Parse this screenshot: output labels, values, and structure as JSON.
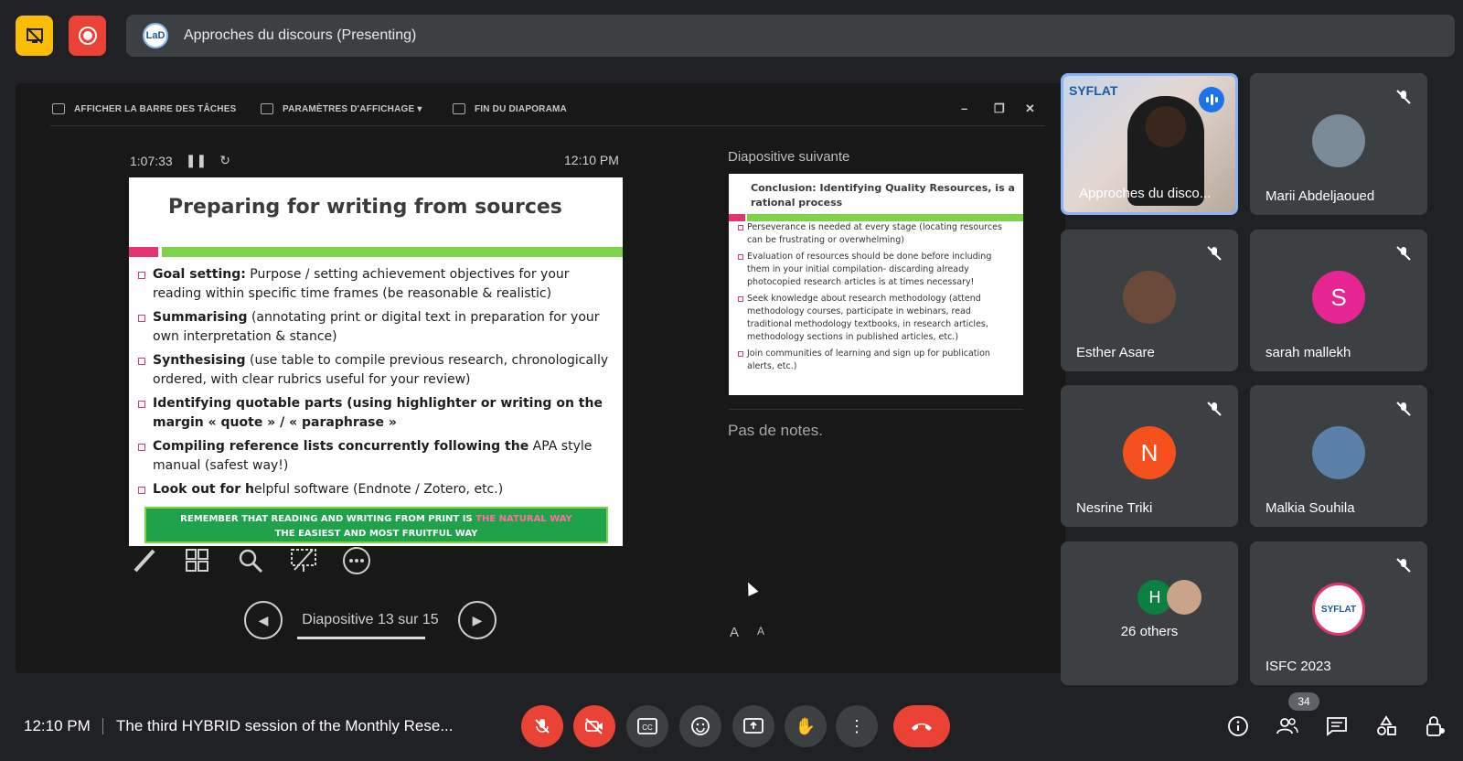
{
  "topbar": {
    "presentation_title": "Approches du discours (Presenting)",
    "logo_text": "LaD",
    "colors": {
      "stop_presenting_bg": "#fbbc04",
      "record_bg": "#ea4335"
    }
  },
  "powerpoint": {
    "toolbar": {
      "taskbar": "AFFICHER LA BARRE DES TÂCHES",
      "display_settings": "PARAMÈTRES D'AFFICHAGE ▾",
      "end_slideshow": "FIN DU DIAPORAMA"
    },
    "timer": "1:07:33",
    "clock": "12:10 PM",
    "current_slide": {
      "title": "Preparing for writing from sources",
      "bullets": [
        {
          "bold": "Goal setting:",
          "text": " Purpose / setting achievement objectives for your reading within specific time frames (be reasonable & realistic)"
        },
        {
          "bold": "Summarising",
          "text": " (annotating print or digital text in preparation for your own interpretation & stance)"
        },
        {
          "bold": "Synthesising",
          "text": " (use table to compile previous research, chronologically ordered, with clear rubrics useful for your review)"
        },
        {
          "bold": "Identifying quotable parts (using highlighter or writing on the margin « quote » / « paraphrase »",
          "text": ""
        },
        {
          "bold": "Compiling reference lists concurrently following the",
          "text": " APA style manual (safest way!)"
        },
        {
          "bold": "Look out for h",
          "text": "elpful software (Endnote / Zotero, etc.)"
        }
      ],
      "banner_line1": "REMEMBER THAT READING AND WRITING FROM PRINT IS ",
      "banner_pink": "THE NATURAL WAY",
      "banner_line2": "THE EASIEST AND MOST FRUITFUL WAY"
    },
    "navigation": {
      "label": "Diapositive 13 sur 15"
    },
    "next_slide": {
      "label": "Diapositive suivante",
      "title": "Conclusion: Identifying Quality Resources, is a rational process",
      "bullets": [
        "Perseverance is needed at every stage (locating resources can be frustrating or overwhelming)",
        "Evaluation of resources should be done before including them in your initial compilation- discarding already photocopied research articles is at times necessary!",
        "Seek knowledge about research methodology (attend methodology courses, participate in webinars, read traditional methodology textbooks, in research articles, methodology sections in published articles, etc.)",
        "Join communities of learning and sign up for publication alerts, etc.)"
      ]
    },
    "notes": "Pas de notes.",
    "font_controls": [
      "A",
      "A"
    ]
  },
  "participants": [
    {
      "name": "Approches du disco...",
      "logo_text": "SYFLAT"
    },
    {
      "name": "Marii Abdeljaoued"
    },
    {
      "name": "Esther Asare"
    },
    {
      "name": "sarah mallekh",
      "initial": "S",
      "color": "#e52592"
    },
    {
      "name": "Nesrine Triki",
      "initial": "N",
      "color": "#f4511e"
    },
    {
      "name": "Malkia Souhila"
    },
    {
      "name": "26 others",
      "initial": "H",
      "color": "#0b8043"
    },
    {
      "name": "ISFC 2023",
      "logo_text": "SYFLAT"
    }
  ],
  "bottombar": {
    "time": "12:10 PM",
    "meeting_title": "The third HYBRID session of the Monthly Rese...",
    "participant_count": "34",
    "colors": {
      "danger": "#ea4335",
      "control_bg": "#3c4043"
    }
  }
}
